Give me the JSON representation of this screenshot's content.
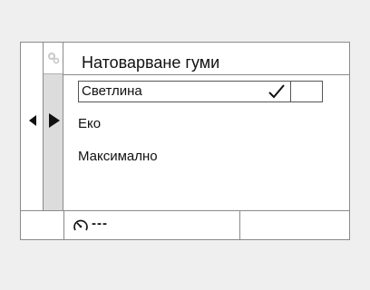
{
  "screen": {
    "title": "Натоварване гуми",
    "options": [
      {
        "label": "Светлина",
        "selected": true
      },
      {
        "label": "Еко",
        "selected": false
      },
      {
        "label": "Максимално",
        "selected": false
      }
    ]
  },
  "footer": {
    "gauge_value": "---"
  },
  "icons": {
    "settings": "settings-icon",
    "check": "checkmark-icon",
    "left": "arrow-left-icon",
    "right": "arrow-right-icon",
    "gauge": "pressure-gauge-icon"
  }
}
